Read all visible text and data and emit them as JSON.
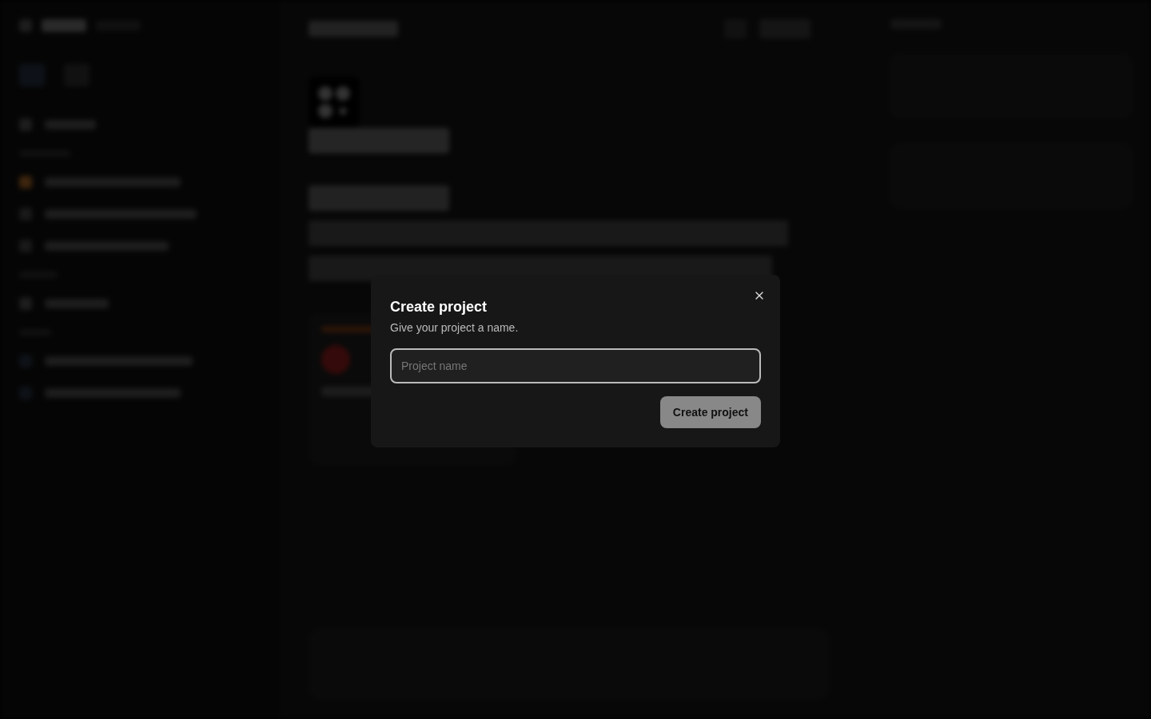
{
  "dialog": {
    "title": "Create project",
    "description": "Give your project a name.",
    "field": {
      "placeholder": "Project name"
    },
    "submit": "Create project"
  }
}
